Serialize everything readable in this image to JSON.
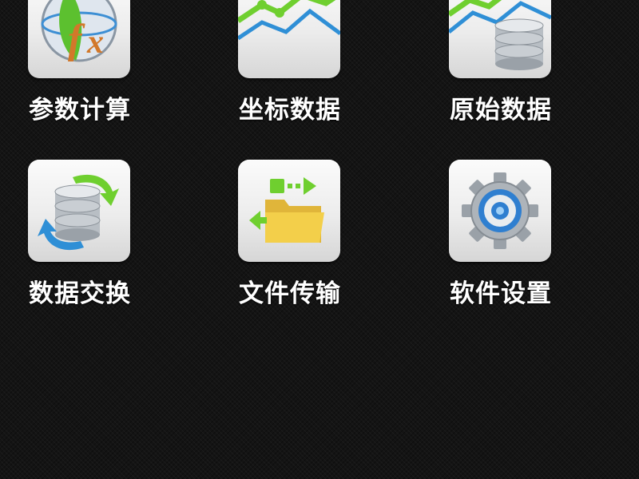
{
  "apps": [
    {
      "id": "param-calc",
      "label": "参数计算",
      "icon": "fx-globe-icon"
    },
    {
      "id": "coord-data",
      "label": "坐标数据",
      "icon": "line-chart-icon"
    },
    {
      "id": "raw-data",
      "label": "原始数据",
      "icon": "chart-database-icon"
    },
    {
      "id": "data-exchange",
      "label": "数据交换",
      "icon": "database-sync-icon"
    },
    {
      "id": "file-transfer",
      "label": "文件传输",
      "icon": "folder-transfer-icon"
    },
    {
      "id": "settings",
      "label": "软件设置",
      "icon": "gear-icon"
    }
  ],
  "colors": {
    "background": "#141414",
    "label": "#ffffff",
    "accent_green": "#6fcf2f",
    "accent_blue": "#2f8fd6",
    "folder_yellow": "#f3cf4a"
  }
}
